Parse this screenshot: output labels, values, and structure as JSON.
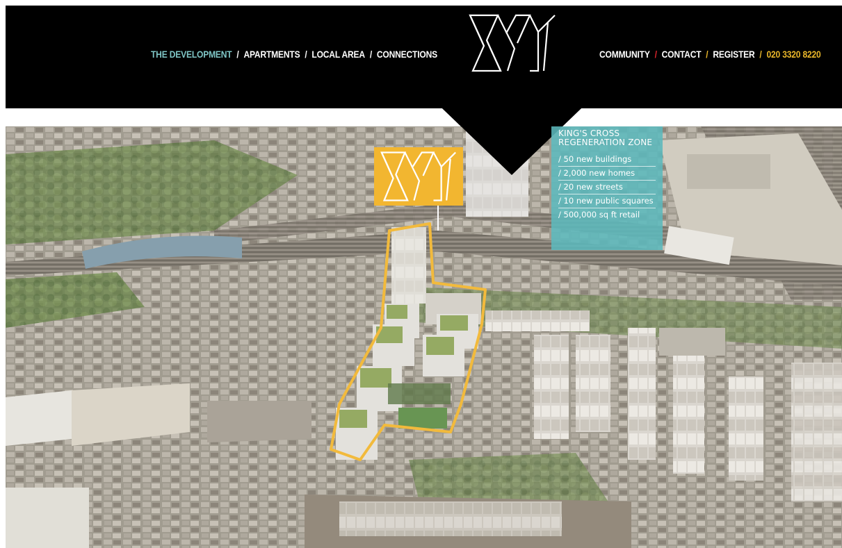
{
  "header": {
    "nav_left": [
      {
        "label": "THE DEVELOPMENT",
        "active": true
      },
      {
        "label": "APARTMENTS",
        "active": false
      },
      {
        "label": "LOCAL AREA",
        "active": false
      },
      {
        "label": "CONNECTIONS",
        "active": false
      }
    ],
    "nav_right": [
      {
        "label": "COMMUNITY"
      },
      {
        "label": "CONTACT"
      },
      {
        "label": "REGISTER"
      }
    ],
    "phone": "020 3320 8220",
    "separator": "/",
    "logo_icon": "xy-logo-icon"
  },
  "info_panel": {
    "title": "KING'S CROSS REGENERATION ZONE",
    "items": [
      "/ 50 new buildings",
      "/ 2,000 new homes",
      "/ 20 new streets",
      "/ 10 new public squares",
      "/ 500,000 sq ft retail"
    ]
  },
  "sign": {
    "icon": "xy-sign-logo-icon"
  },
  "colors": {
    "header_bg": "#000000",
    "active_nav": "#7fc6c6",
    "phone": "#e9b62a",
    "panel": "#5cb8bc",
    "sign": "#f2b630",
    "outline": "#f2b630"
  }
}
